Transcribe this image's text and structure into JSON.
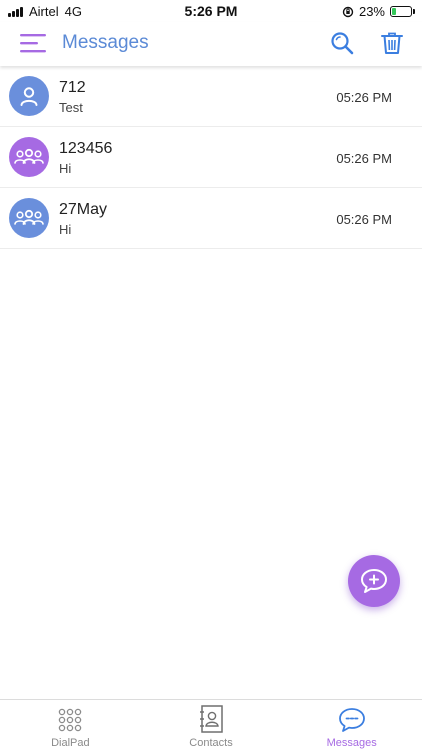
{
  "status_bar": {
    "carrier": "Airtel",
    "network": "4G",
    "time": "5:26 PM",
    "battery": "23%",
    "battery_level": 0.23
  },
  "header": {
    "title": "Messages",
    "menu_icon": "hamburger-menu-icon",
    "search_icon": "search-icon",
    "delete_icon": "trash-icon"
  },
  "messages": [
    {
      "name": "712",
      "preview": "Test",
      "time": "05:26 PM",
      "avatar": "person-icon",
      "color": "#6a8fdc"
    },
    {
      "name": "123456",
      "preview": "Hi",
      "time": "05:26 PM",
      "avatar": "group-icon",
      "color": "#a66ae3"
    },
    {
      "name": "27May",
      "preview": "Hi",
      "time": "05:26 PM",
      "avatar": "group-icon",
      "color": "#6a8fdc"
    }
  ],
  "fab": {
    "icon": "new-message-icon"
  },
  "tabs": [
    {
      "label": "DialPad",
      "icon": "dialpad-icon",
      "active": false
    },
    {
      "label": "Contacts",
      "icon": "contacts-book-icon",
      "active": false
    },
    {
      "label": "Messages",
      "icon": "chat-bubble-icon",
      "active": true
    }
  ],
  "colors": {
    "accent_purple": "#a66ae3",
    "accent_blue": "#5b8ad6",
    "battery_green": "#34c759"
  }
}
